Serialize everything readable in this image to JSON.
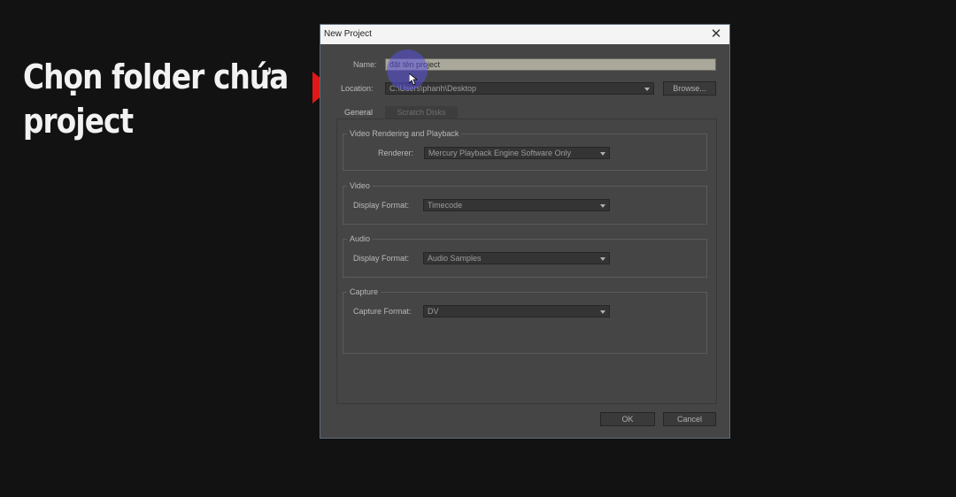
{
  "caption": {
    "line1": "Chọn folder chứa",
    "line2": "project",
    "arrow_color": "#e01818"
  },
  "dialog": {
    "title": "New Project",
    "close_icon": "✕",
    "name": {
      "label": "Name:",
      "value": "đặt tên project"
    },
    "location": {
      "label": "Location:",
      "value": "C:\\Users\\phanh\\Desktop",
      "browse_label": "Browse..."
    },
    "tabs": {
      "general": "General",
      "scratch_disks": "Scratch Disks"
    },
    "video_rendering": {
      "title": "Video Rendering and Playback",
      "renderer_label": "Renderer:",
      "renderer_value": "Mercury Playback Engine Software Only"
    },
    "video": {
      "title": "Video",
      "display_format_label": "Display Format:",
      "display_format_value": "Timecode"
    },
    "audio": {
      "title": "Audio",
      "display_format_label": "Display Format:",
      "display_format_value": "Audio Samples"
    },
    "capture": {
      "title": "Capture",
      "capture_format_label": "Capture Format:",
      "capture_format_value": "DV"
    },
    "buttons": {
      "ok": "OK",
      "cancel": "Cancel"
    }
  },
  "colors": {
    "background": "#121212",
    "dialog_bg": "#454545",
    "titlebar_bg": "#f4f4f4",
    "cursor_highlight": "#5a50dc"
  }
}
